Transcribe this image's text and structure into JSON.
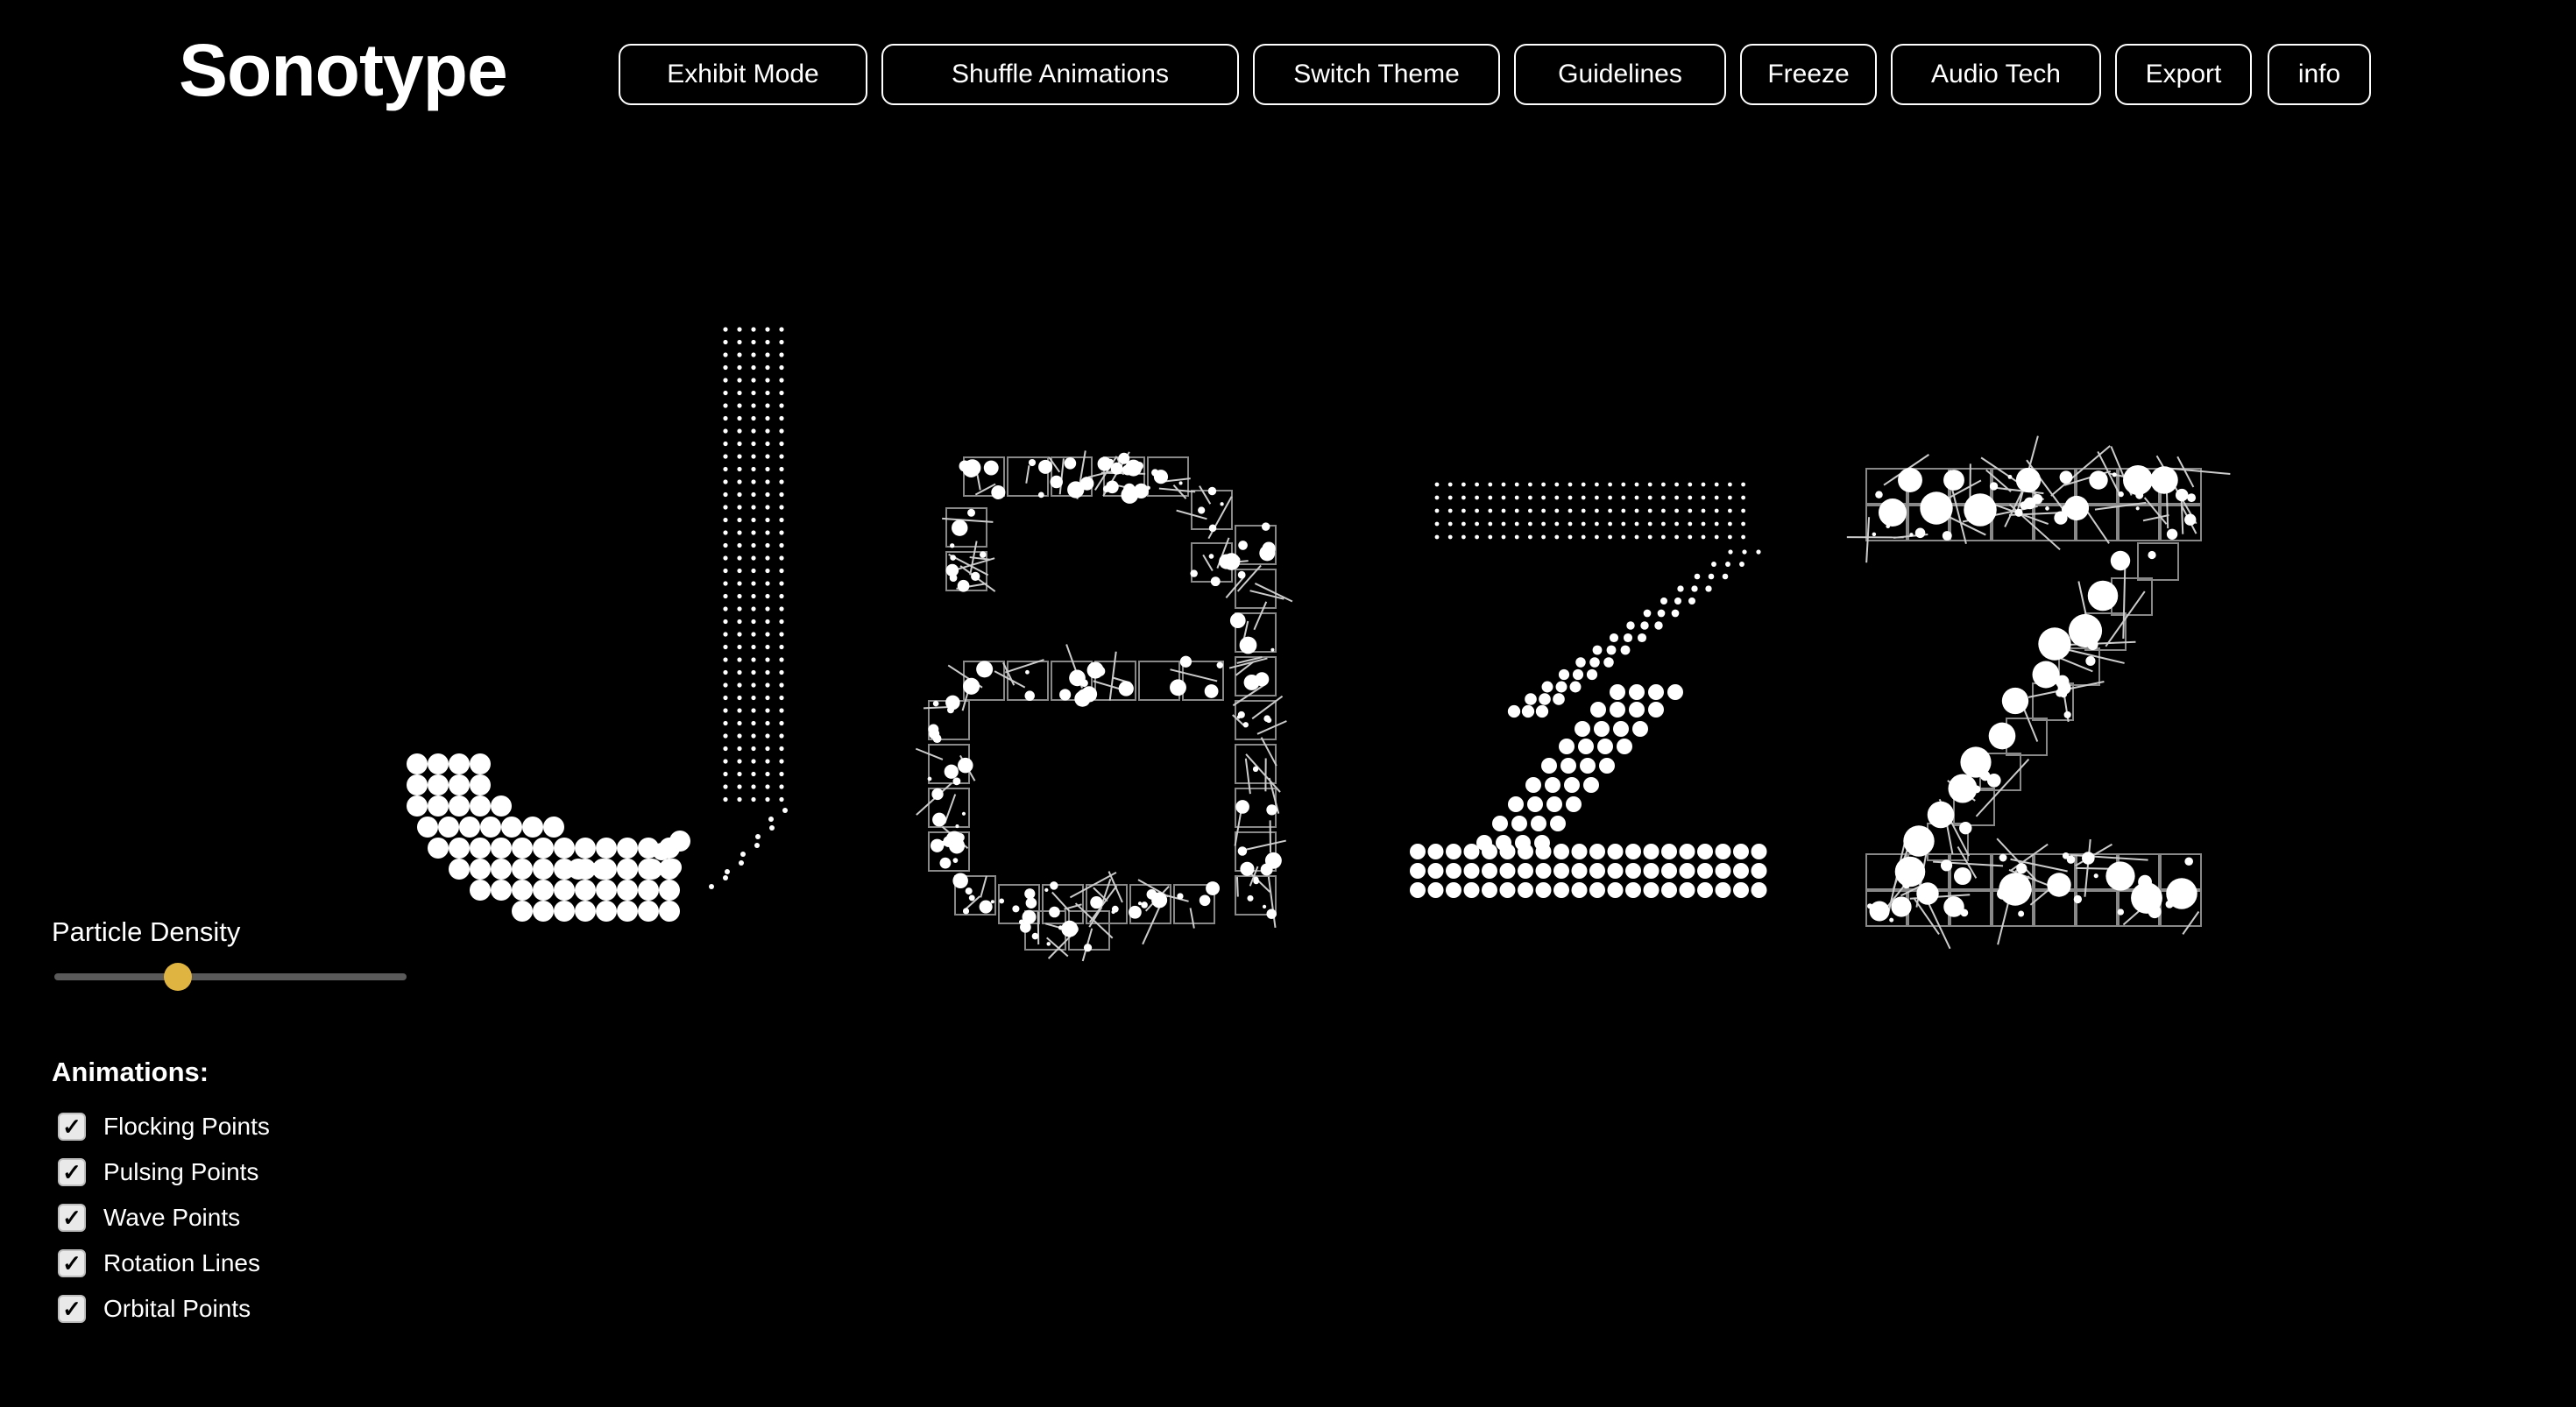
{
  "app": {
    "title": "Sonotype"
  },
  "toolbar": {
    "buttons": [
      {
        "id": "exhibit",
        "label": "Exhibit Mode"
      },
      {
        "id": "shuffle",
        "label": "Shuffle Animations"
      },
      {
        "id": "theme",
        "label": "Switch Theme"
      },
      {
        "id": "guidelines",
        "label": "Guidelines"
      },
      {
        "id": "freeze",
        "label": "Freeze"
      },
      {
        "id": "audio",
        "label": "Audio Tech"
      },
      {
        "id": "export",
        "label": "Export"
      },
      {
        "id": "info",
        "label": "info"
      }
    ]
  },
  "artwork": {
    "word": "Jazz"
  },
  "controls": {
    "density": {
      "label": "Particle Density",
      "value": 0.35,
      "accent": "#e0b440"
    },
    "animations": {
      "heading": "Animations:",
      "items": [
        {
          "label": "Flocking Points",
          "checked": true
        },
        {
          "label": "Pulsing Points",
          "checked": true
        },
        {
          "label": "Wave Points",
          "checked": true
        },
        {
          "label": "Rotation Lines",
          "checked": true
        },
        {
          "label": "Orbital Points",
          "checked": true
        }
      ]
    }
  },
  "theme": {
    "background": "#000000",
    "foreground": "#ffffff"
  }
}
